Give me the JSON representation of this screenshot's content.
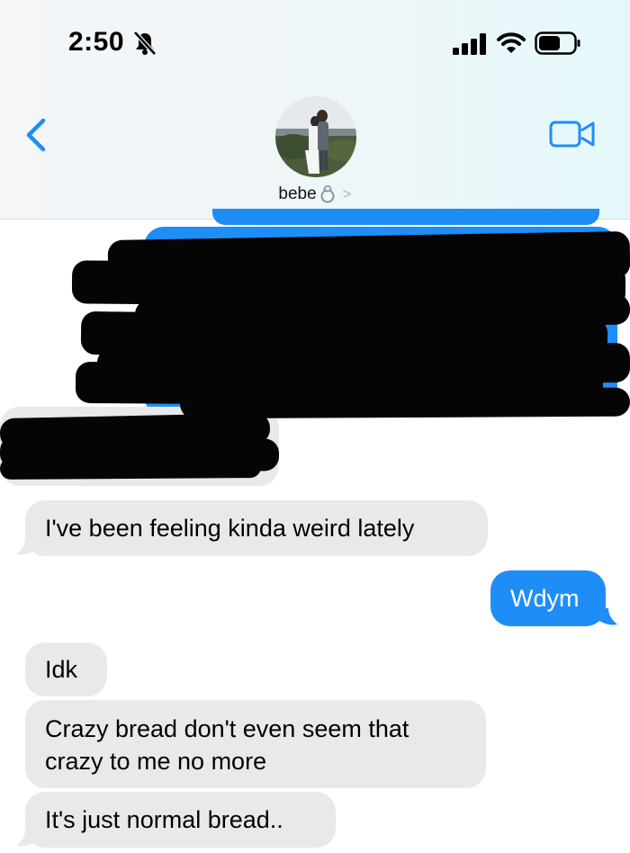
{
  "status": {
    "time": "2:50",
    "silent_icon": "bell-slash-icon",
    "signal_icon": "cellular-signal-icon",
    "wifi_icon": "wifi-icon",
    "battery_icon": "battery-icon"
  },
  "header": {
    "contact_name": "bebe",
    "contact_emoji": "ring-icon",
    "back_icon": "chevron-left-icon",
    "video_icon": "video-camera-icon"
  },
  "messages": [
    {
      "side": "incoming",
      "text": "I've been feeling kinda weird lately"
    },
    {
      "side": "outgoing",
      "text": "Wdym"
    },
    {
      "side": "incoming",
      "text": "Idk"
    },
    {
      "side": "incoming",
      "lines": [
        "Crazy bread don't even seem that",
        "crazy to me no more"
      ]
    },
    {
      "side": "incoming",
      "text": "It's just normal bread.."
    }
  ],
  "colors": {
    "accent": "#1f8df6",
    "incoming_bubble": "#e9e9eb",
    "redaction": "#050505"
  }
}
